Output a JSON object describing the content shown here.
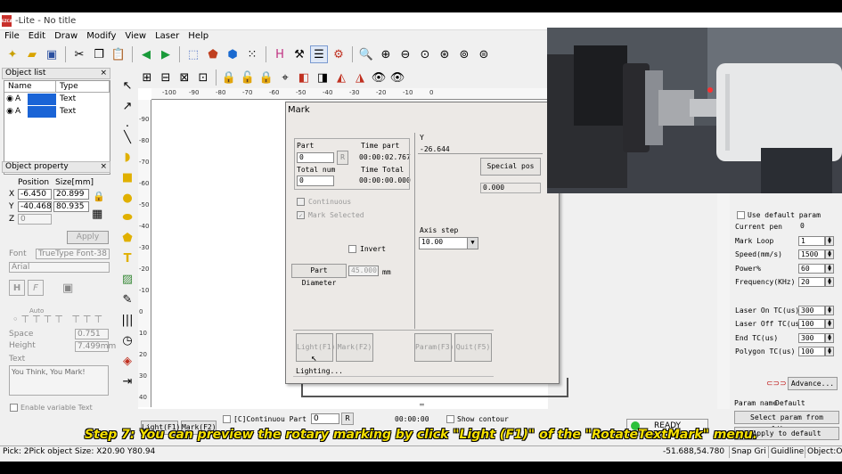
{
  "app": {
    "title": "-Lite - No title",
    "logo": "EZCAD"
  },
  "menu": [
    "File",
    "Edit",
    "Draw",
    "Modify",
    "View",
    "Laser",
    "Help"
  ],
  "object_list": {
    "title": "Object list",
    "columns": [
      "Name",
      "Type"
    ],
    "rows": [
      {
        "name": "A",
        "type": "Text"
      },
      {
        "name": "A",
        "type": "Text"
      }
    ],
    "swatch_color": "#1a64d6"
  },
  "object_property": {
    "title": "Object property",
    "position_label": "Position",
    "size_label": "Size[mm]",
    "x_label": "X",
    "y_label": "Y",
    "z_label": "Z",
    "x_pos": "-6.450",
    "x_size": "20.899",
    "y_pos": "-40.468",
    "y_size": "80.935",
    "z_pos": "0",
    "apply": "Apply",
    "font_label": "Font",
    "font_type": "TrueType Font-38",
    "font_name": "Arial",
    "auto": "Auto",
    "space_label": "Space",
    "space_value": "0.751",
    "height_label": "Height",
    "height_value": "7.499mm",
    "text_label": "Text",
    "text_value": "You Think, You Mark!",
    "enable_variable": "Enable variable Text"
  },
  "ruler": {
    "h_ticks": [
      "-100",
      "-90",
      "-80",
      "-70",
      "-60",
      "-50",
      "-40",
      "-30",
      "-20",
      "-10",
      "0"
    ],
    "v_ticks": [
      "-90",
      "-80",
      "-70",
      "-60",
      "-50",
      "-40",
      "-30",
      "-20",
      "-10",
      "0",
      "10",
      "20",
      "30",
      "40"
    ]
  },
  "mark_dialog": {
    "title": "Mark",
    "part_label": "Part",
    "part_value": "0",
    "r_button": "R",
    "time_part_label": "Time part",
    "time_part_value": "00:00:02.767",
    "total_num_label": "Total num",
    "total_num_value": "0",
    "time_total_label": "Time Total",
    "time_total_value": "00:00:00.000",
    "continuous": "Continuous",
    "mark_selected": "Mark Selected",
    "y_label": "Y",
    "y_value": "-26.644",
    "special_pos": "Special pos",
    "special_value": "0.000",
    "axis_step_label": "Axis step",
    "axis_step_value": "10.00",
    "invert": "Invert",
    "part_diameter": "Part Diameter",
    "part_diameter_value": "45.000",
    "part_diameter_unit": "mm",
    "light_button": "Light(F1)",
    "mark_button": "Mark(F2)",
    "param_button": "Param(F3)",
    "quit_button": "Quit(F5)",
    "status": "Lighting..."
  },
  "right_panel": {
    "colors": [
      "#000000",
      "#0000ff",
      "#ff0000",
      "#00c000",
      "#ff00ff",
      "#e8e800",
      "#ff8c00",
      "#8b0000"
    ],
    "use_default": "Use default param",
    "params": [
      {
        "label": "Current pen",
        "value": "0"
      },
      {
        "label": "Mark Loop",
        "value": "1"
      },
      {
        "label": "Speed(mm/s)",
        "value": "1500"
      },
      {
        "label": "Power%",
        "value": "60"
      },
      {
        "label": "Frequency(KHz)",
        "value": "20"
      }
    ],
    "params2": [
      {
        "label": "Laser On TC(us)",
        "value": "300"
      },
      {
        "label": "Laser Off TC(us)",
        "value": "100"
      },
      {
        "label": "End TC(us)",
        "value": "300"
      },
      {
        "label": "Polygon TC(us)",
        "value": "100"
      }
    ],
    "advance": "Advance...",
    "param_name_label": "Param name",
    "param_name_value": "Default",
    "select_param": "Select param from library",
    "apply_default": "Apply to default"
  },
  "bottom_bar": {
    "light": "Light(F1)",
    "mark": "Mark(F2)",
    "continuous_part": "[C]Continuou Part",
    "part_value": "0",
    "r_button": "R",
    "time_value": "00:00:00",
    "show_contour": "Show contour",
    "ready": "READY"
  },
  "status_bar": {
    "left": "Pick: 2Pick object Size: X20.90 Y80.94",
    "coords": "-51.688,54.780",
    "snap": "Snap Gri",
    "guideline": "Guidline:",
    "object": "Object:O"
  },
  "caption": "Step 7: You can preview the rotary marking by click \"Light (F1)\" of the \"RotateTextMark\" menu."
}
